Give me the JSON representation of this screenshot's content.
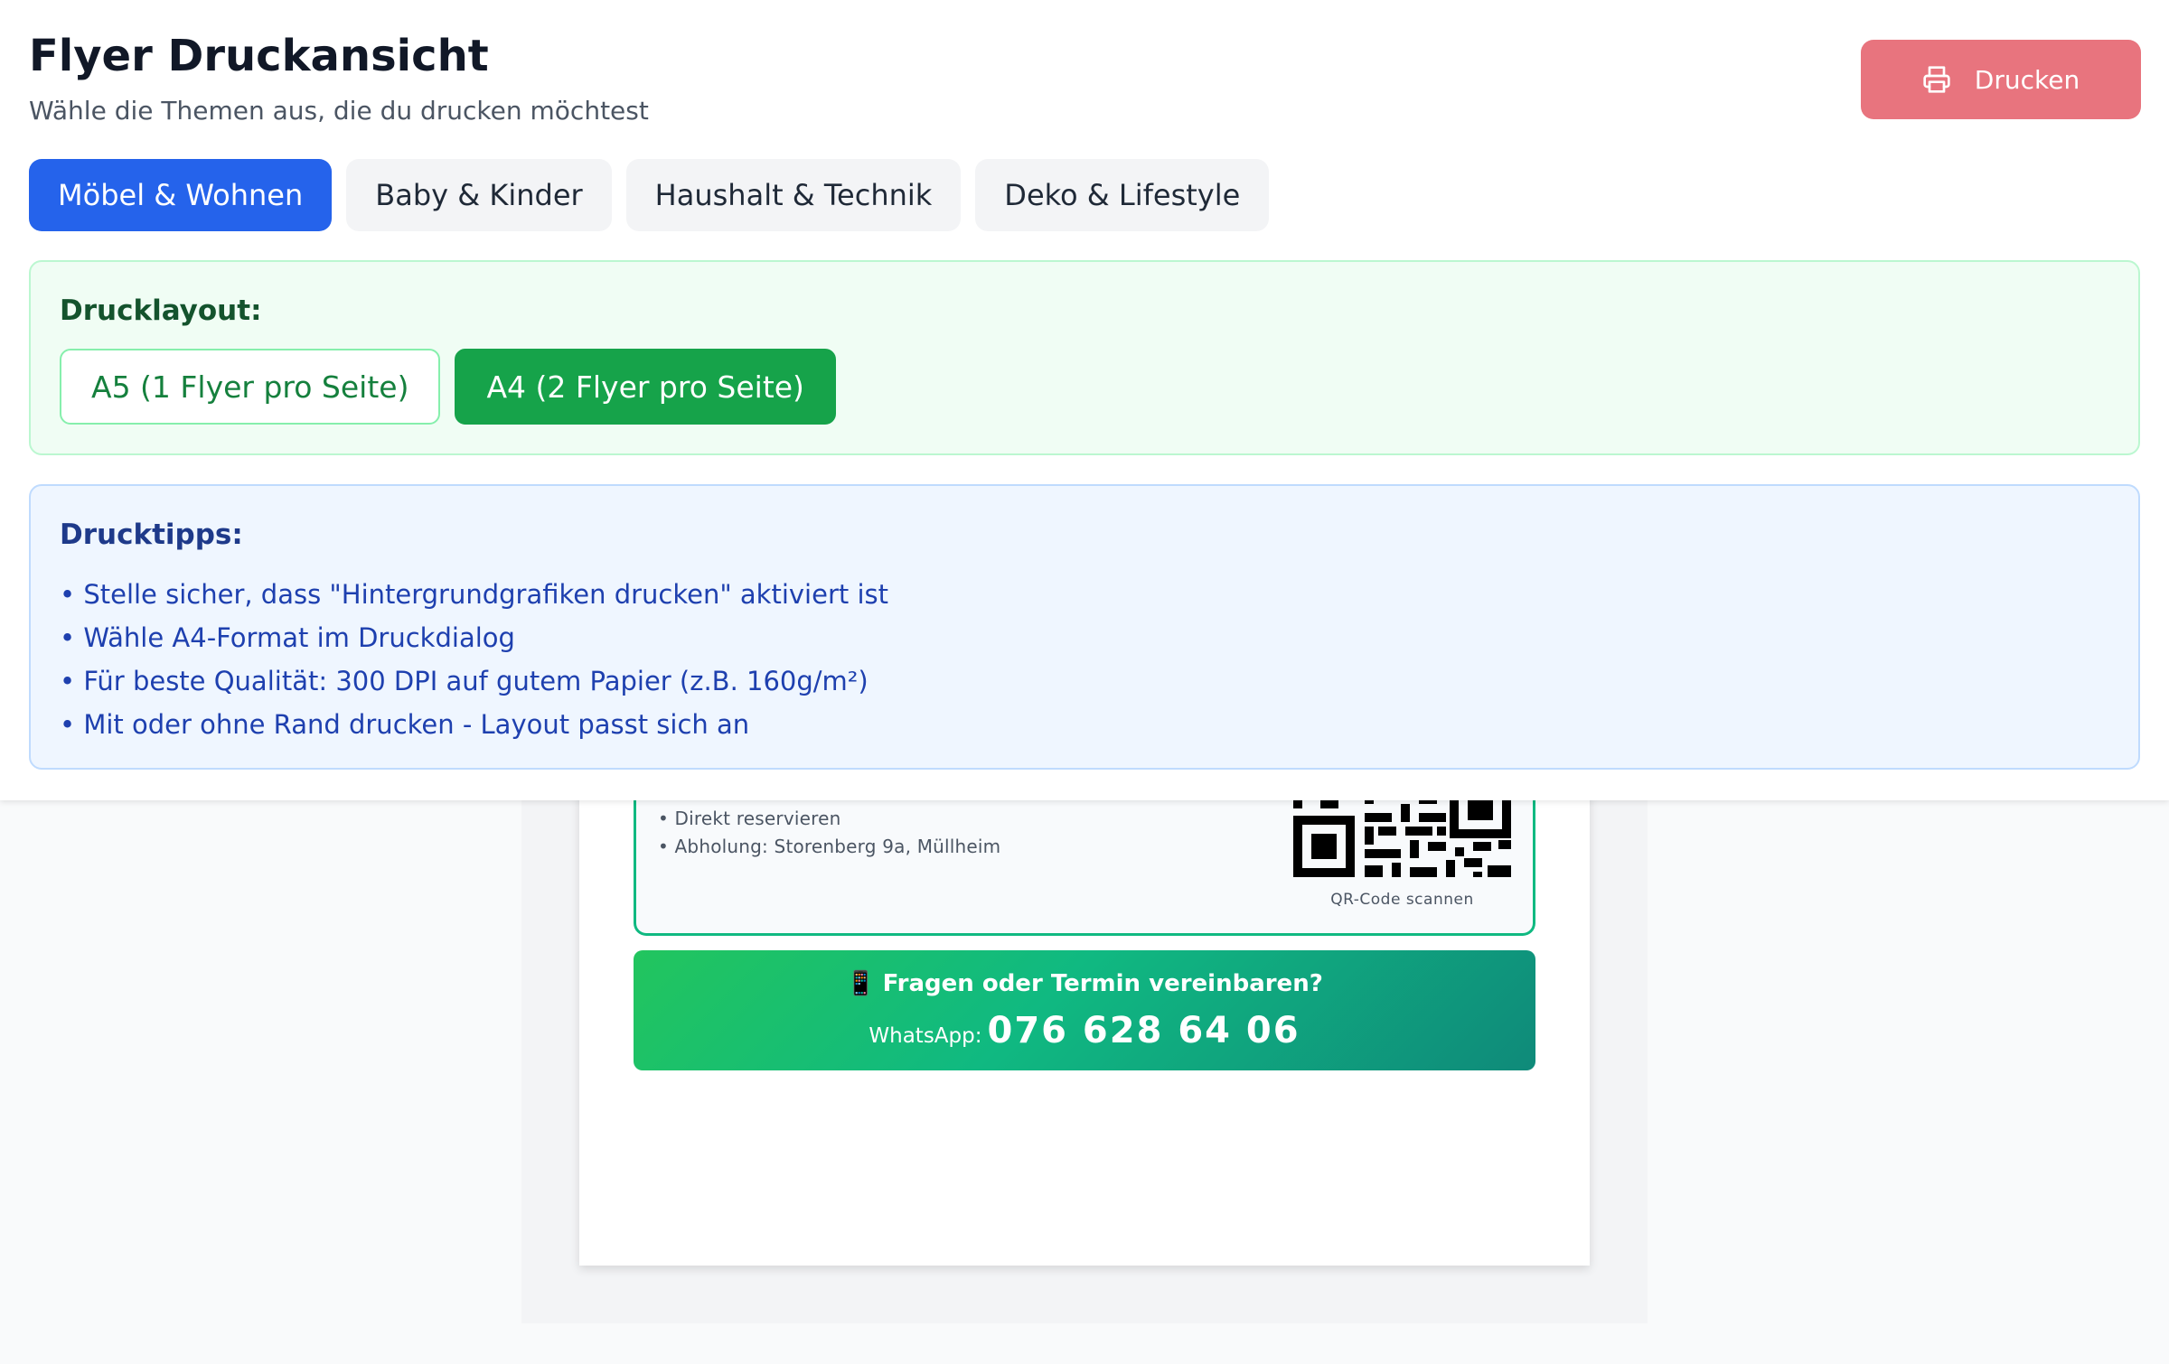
{
  "header": {
    "title": "Flyer Druckansicht",
    "subtitle": "Wähle die Themen aus, die du drucken möchtest",
    "print_button_label": "Drucken",
    "print_icon": "printer-icon"
  },
  "tabs": [
    {
      "label": "Möbel & Wohnen",
      "active": true
    },
    {
      "label": "Baby & Kinder",
      "active": false
    },
    {
      "label": "Haushalt & Technik",
      "active": false
    },
    {
      "label": "Deko & Lifestyle",
      "active": false
    }
  ],
  "layout": {
    "label": "Drucklayout:",
    "options": [
      {
        "label": "A5 (1 Flyer pro Seite)",
        "active": false
      },
      {
        "label": "A4 (2 Flyer pro Seite)",
        "active": true
      }
    ]
  },
  "tips": {
    "title": "Drucktipps:",
    "items": [
      "• Stelle sicher, dass \"Hintergrundgrafiken drucken\" aktiviert ist",
      "• Wähle A4-Format im Druckdialog",
      "• Für beste Qualität: 300 DPI auf gutem Papier (z.B. 160g/m²)",
      "• Mit oder ohne Rand drucken - Layout passt sich an"
    ]
  },
  "flyer": {
    "bullets": [
      "• Direkt reservieren",
      "• Abholung: Storenberg 9a, Müllheim"
    ],
    "qr_caption": "QR-Code scannen",
    "contact_question": "Fragen oder Termin vereinbaren?",
    "contact_icon": "📱",
    "whatsapp_label": "WhatsApp:",
    "whatsapp_number": "076 628 64 06"
  },
  "colors": {
    "primary_blue": "#2563eb",
    "print_button": "#e8747e",
    "layout_green": "#16a34a",
    "tips_blue": "#1e40af",
    "whatsapp_gradient_start": "#22c55e",
    "whatsapp_gradient_end": "#0f8a7a"
  }
}
